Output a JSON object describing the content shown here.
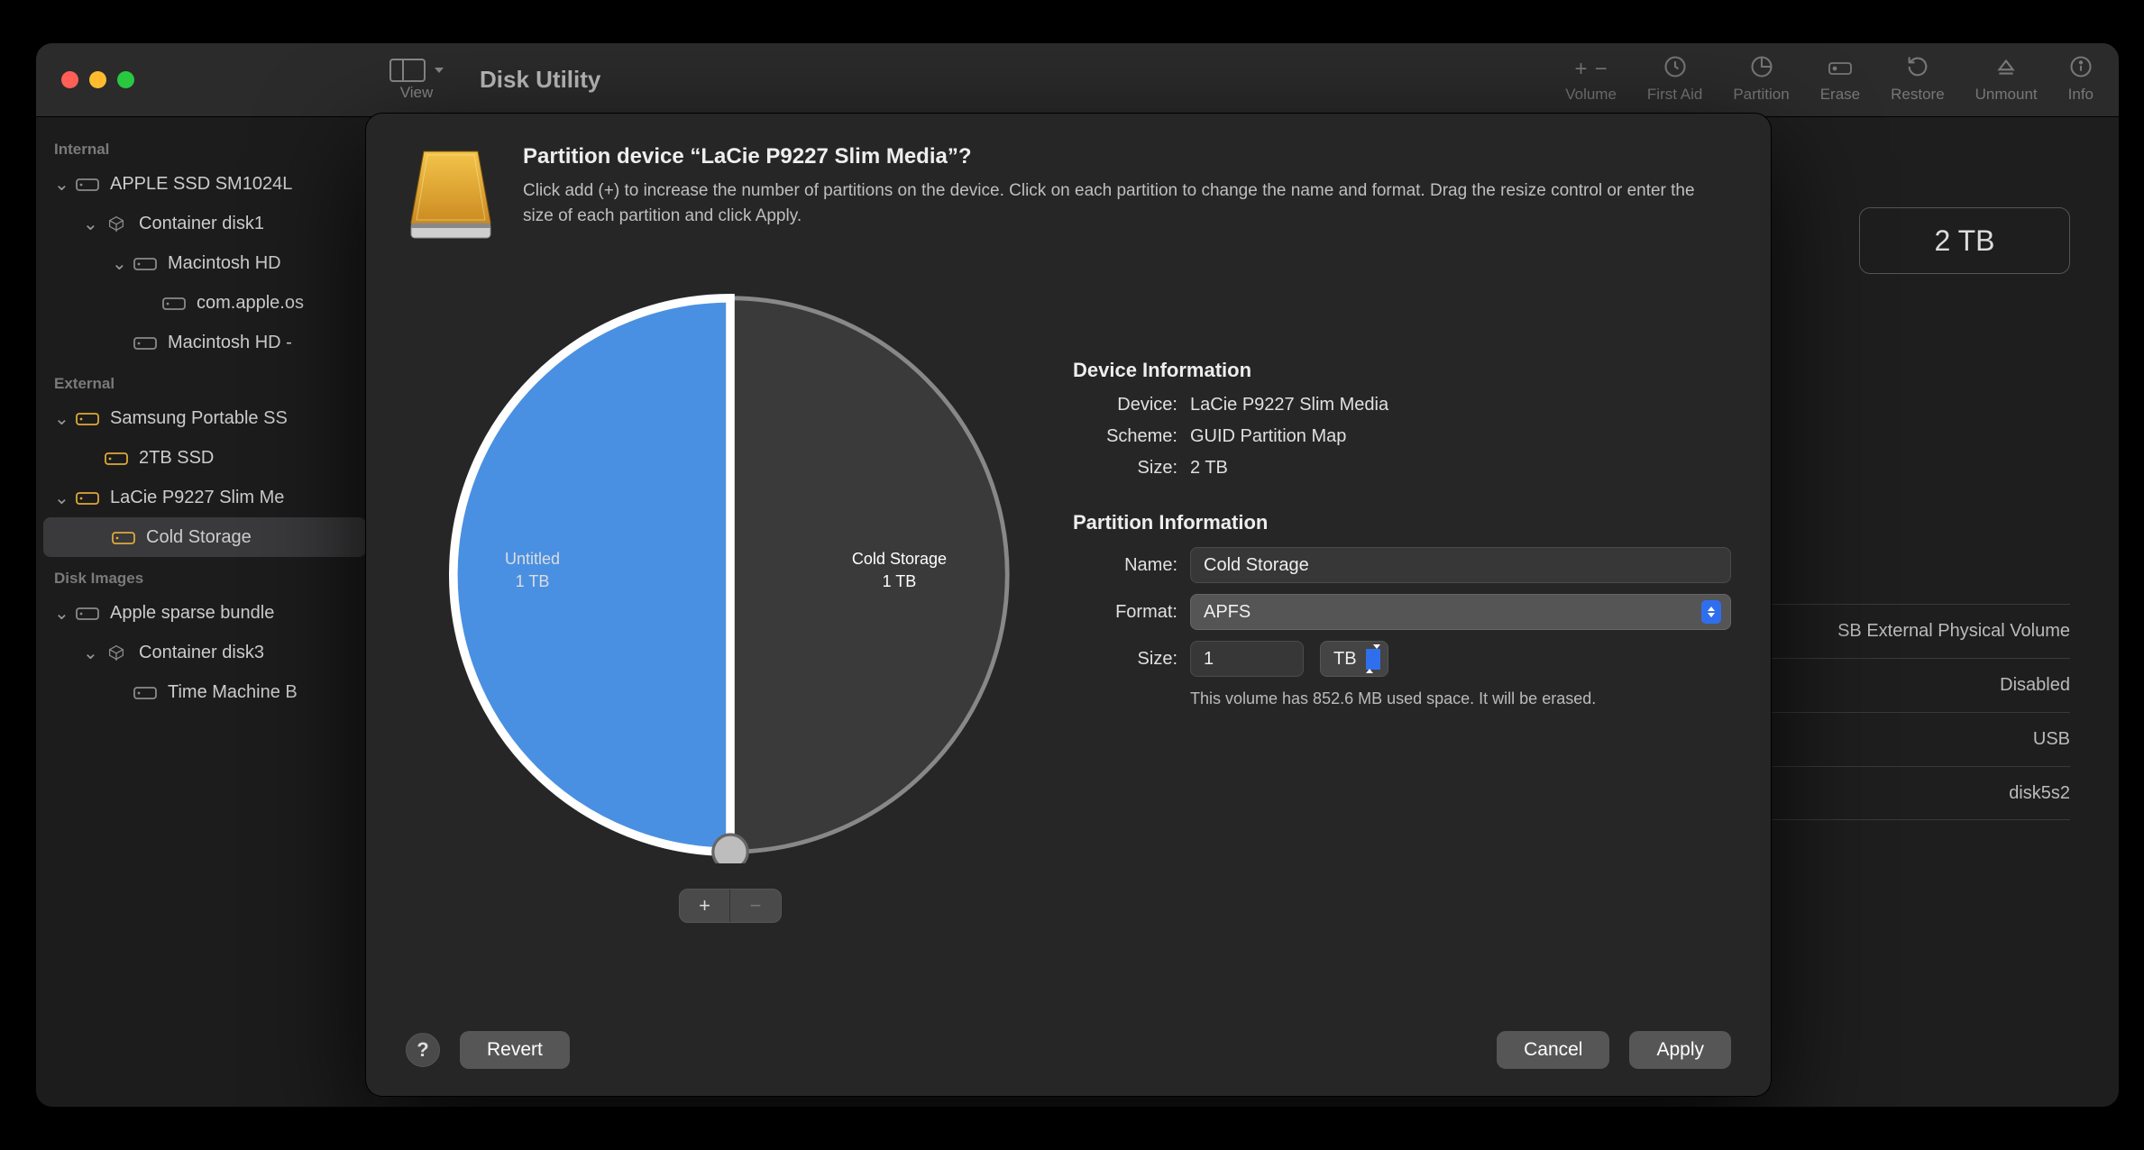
{
  "app_title": "Disk Utility",
  "toolbar": {
    "view_label": "View",
    "volume": "Volume",
    "first_aid": "First Aid",
    "partition": "Partition",
    "erase": "Erase",
    "restore": "Restore",
    "unmount": "Unmount",
    "info": "Info"
  },
  "capacity_pill": "2 TB",
  "sidebar": {
    "sections": [
      {
        "header": "Internal",
        "items": [
          {
            "label": "APPLE SSD SM1024L",
            "indent": 0,
            "icon": "disk",
            "disclosure": true
          },
          {
            "label": "Container disk1",
            "indent": 1,
            "icon": "container",
            "disclosure": true
          },
          {
            "label": "Macintosh HD",
            "indent": 2,
            "icon": "vol",
            "disclosure": true
          },
          {
            "label": "com.apple.os",
            "indent": 3,
            "icon": "vol",
            "disclosure": false
          },
          {
            "label": "Macintosh HD -",
            "indent": 2,
            "icon": "vol",
            "disclosure": false
          }
        ]
      },
      {
        "header": "External",
        "items": [
          {
            "label": "Samsung Portable SS",
            "indent": 0,
            "icon": "ext",
            "disclosure": true
          },
          {
            "label": "2TB SSD",
            "indent": 1,
            "icon": "ext",
            "disclosure": false
          },
          {
            "label": "LaCie P9227 Slim Me",
            "indent": 0,
            "icon": "ext",
            "disclosure": true
          },
          {
            "label": "Cold Storage",
            "indent": 1,
            "icon": "ext",
            "disclosure": false,
            "selected": true
          }
        ]
      },
      {
        "header": "Disk Images",
        "items": [
          {
            "label": "Apple sparse bundle",
            "indent": 0,
            "icon": "disk",
            "disclosure": true
          },
          {
            "label": "Container disk3",
            "indent": 1,
            "icon": "container",
            "disclosure": true
          },
          {
            "label": "Time Machine B",
            "indent": 2,
            "icon": "vol",
            "disclosure": false
          }
        ]
      }
    ]
  },
  "background_info": {
    "rows": [
      {
        "value": "SB External Physical Volume"
      },
      {
        "value": "Disabled"
      },
      {
        "value": "USB"
      },
      {
        "value": "disk5s2"
      }
    ]
  },
  "dialog": {
    "title": "Partition device “LaCie P9227 Slim Media”?",
    "subtitle": "Click add (+) to increase the number of partitions on the device. Click on each partition to change the name and format. Drag the resize control or enter the size of each partition and click Apply.",
    "device_info_header": "Device Information",
    "device_label": "Device:",
    "device_value": "LaCie P9227 Slim Media",
    "scheme_label": "Scheme:",
    "scheme_value": "GUID Partition Map",
    "dsize_label": "Size:",
    "dsize_value": "2 TB",
    "partition_info_header": "Partition Information",
    "name_label": "Name:",
    "name_value": "Cold Storage",
    "format_label": "Format:",
    "format_value": "APFS",
    "psize_label": "Size:",
    "psize_value": "1",
    "psize_unit": "TB",
    "note": "This volume has 852.6 MB used space. It will be erased.",
    "help": "?",
    "revert": "Revert",
    "cancel": "Cancel",
    "apply": "Apply",
    "plus": "+",
    "minus": "−"
  },
  "chart_data": {
    "type": "pie",
    "title": "Partition layout",
    "slices": [
      {
        "name": "Untitled",
        "value": 1,
        "unit": "TB",
        "color": "#3a3a3a"
      },
      {
        "name": "Cold Storage",
        "value": 1,
        "unit": "TB",
        "color": "#4a90e2"
      }
    ],
    "total": {
      "value": 2,
      "unit": "TB"
    }
  },
  "pie_labels": {
    "left_name": "Untitled",
    "left_size": "1 TB",
    "right_name": "Cold Storage",
    "right_size": "1 TB"
  }
}
